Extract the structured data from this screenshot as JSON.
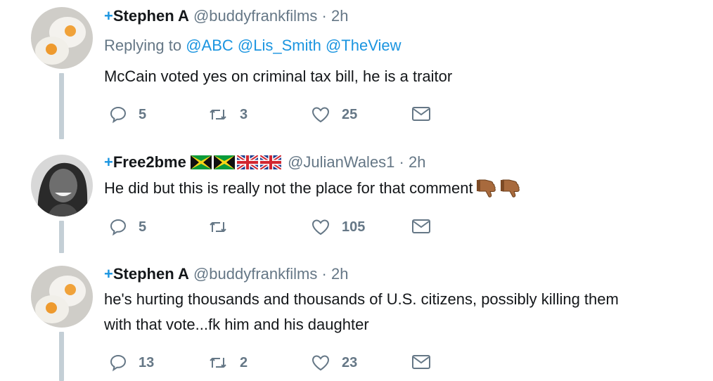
{
  "tweets": [
    {
      "plus": "+",
      "name": "Stephen A",
      "handle": "@buddyfrankfilms",
      "dot": "·",
      "time": "2h",
      "replying_prefix": "Replying to",
      "mentions": [
        "@ABC",
        "@Lis_Smith",
        "@TheView"
      ],
      "text_lines": [
        "McCain voted yes on criminal tax bill, he is a traitor"
      ],
      "replies": "5",
      "retweets": "3",
      "likes": "25"
    },
    {
      "plus": "+",
      "name": "Free2bme",
      "flags": [
        "jamaica-flag",
        "jamaica-flag",
        "uk-flag",
        "uk-flag"
      ],
      "handle": "@JulianWales1",
      "dot": "·",
      "time": "2h",
      "text_lines": [
        "He did but this is really not the place for that comment"
      ],
      "emoji": [
        "thumbs-down-icon",
        "thumbs-down-icon"
      ],
      "replies": "5",
      "retweets": "",
      "likes": "105"
    },
    {
      "plus": "+",
      "name": "Stephen A",
      "handle": "@buddyfrankfilms",
      "dot": "·",
      "time": "2h",
      "text_lines": [
        "he's hurting thousands and thousands of U.S. citizens, possibly killing them",
        "with that vote...fk him and his daughter"
      ],
      "replies": "13",
      "retweets": "2",
      "likes": "23"
    }
  ],
  "colors": {
    "link": "#1b95e0",
    "muted": "#657786",
    "text": "#14171a",
    "thread": "#c4cfd6"
  }
}
